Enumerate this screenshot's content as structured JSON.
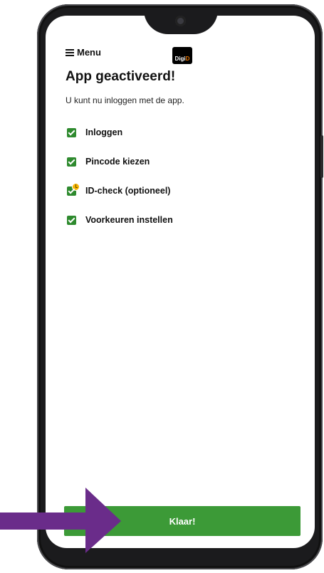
{
  "header": {
    "menu_label": "Menu",
    "logo": {
      "text_part": "Digi",
      "accent_part": "D"
    }
  },
  "main": {
    "title": "App geactiveerd!",
    "subtitle": "U kunt nu inloggen met de app.",
    "steps": [
      {
        "label": "Inloggen",
        "icon": "check-icon",
        "status": "done"
      },
      {
        "label": "Pincode kiezen",
        "icon": "check-icon",
        "status": "done"
      },
      {
        "label": "ID-check (optioneel)",
        "icon": "check-clock-icon",
        "status": "pending"
      },
      {
        "label": "Voorkeuren instellen",
        "icon": "check-icon",
        "status": "done"
      }
    ]
  },
  "footer": {
    "done_button_label": "Klaar!"
  },
  "colors": {
    "primary_green": "#3c9a37",
    "check_green": "#2e8a2e",
    "pending_yellow": "#f6b400",
    "logo_accent": "#e17000",
    "annotation_arrow": "#6a2c8a"
  }
}
